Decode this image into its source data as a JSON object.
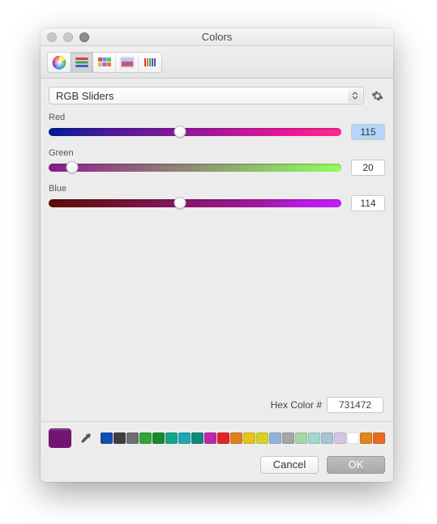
{
  "window": {
    "title": "Colors"
  },
  "modes": [
    "color-wheel-icon",
    "sliders-icon",
    "palettes-icon",
    "image-icon",
    "pencils-icon"
  ],
  "dropdown": {
    "label": "RGB Sliders"
  },
  "sliders": {
    "red": {
      "label": "Red",
      "value": "115",
      "percent": 45,
      "gradient": "linear-gradient(90deg,#001b9a,#4a1a9a,#7d189a,#b3179a,#e8169a,#ff2a8e)"
    },
    "green": {
      "label": "Green",
      "value": "20",
      "percent": 8,
      "gradient": "linear-gradient(90deg,#8a1a8f,#8f4b84,#8f7a79,#8fa870,#8fd468,#8fff60)"
    },
    "blue": {
      "label": "Blue",
      "value": "114",
      "percent": 45,
      "gradient": "linear-gradient(90deg,#5e0e00,#6b1020,#781240,#861460,#931680,#a018a0,#b61ae0,#c41dff)"
    }
  },
  "hex": {
    "label": "Hex Color #",
    "value": "731472"
  },
  "current_color": "#731472",
  "palette": [
    "#0f4db2",
    "#3e3e3e",
    "#6e6e6e",
    "#2fa63b",
    "#188a2d",
    "#17a589",
    "#1fa7b5",
    "#12877e",
    "#c026a8",
    "#e0242a",
    "#e07f1f",
    "#e8c21d",
    "#d6d12a",
    "#8fb4d8",
    "#a6a6a6",
    "#a6d6a6",
    "#a6d6cf",
    "#a6c5d6",
    "#d6c5e6",
    "#ffffff",
    "#e0851f",
    "#e86b1d"
  ],
  "buttons": {
    "cancel": "Cancel",
    "ok": "OK"
  }
}
